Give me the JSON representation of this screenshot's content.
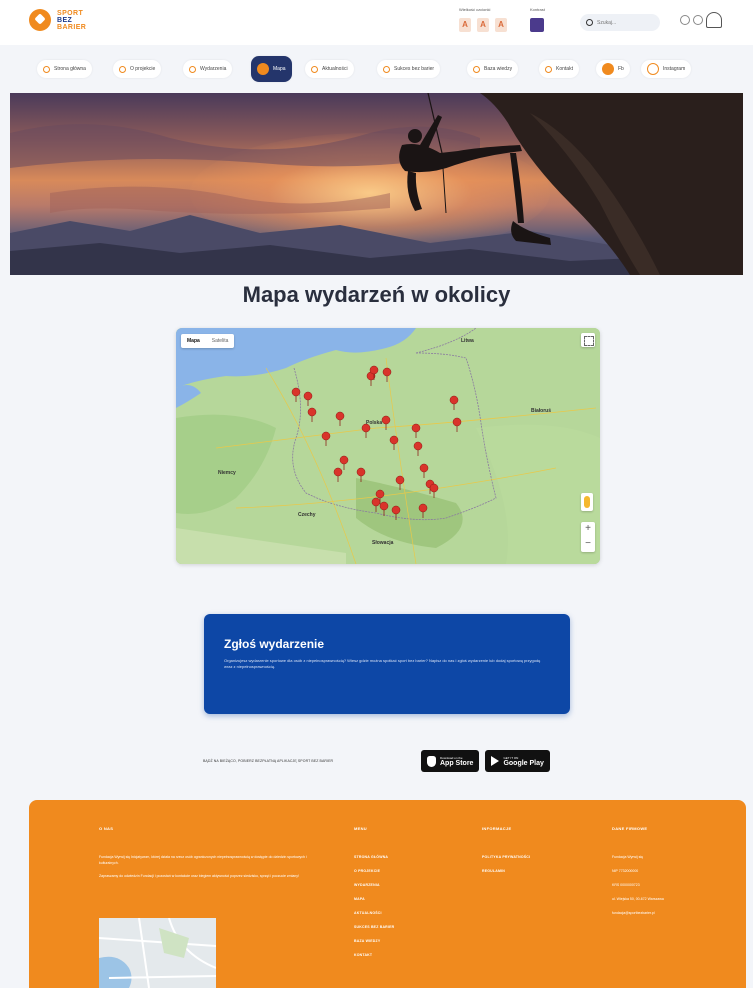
{
  "brand": {
    "logo_lines": [
      "SPORT",
      "BEZ",
      "BARIER"
    ]
  },
  "header": {
    "font_size_label": "Wielkość czcionki",
    "font_size_buttons": [
      "A",
      "A",
      "A"
    ],
    "contrast_label": "Kontrast",
    "search_placeholder": "Szukaj..."
  },
  "nav": {
    "items": [
      {
        "label": "Strona główna"
      },
      {
        "label": "O projekcie"
      },
      {
        "label": "Wydarzenia"
      },
      {
        "label": "Mapa",
        "active": true
      },
      {
        "label": "Aktualności"
      },
      {
        "label": "Sukces bez barier"
      },
      {
        "label": "Baza wiedzy"
      },
      {
        "label": "Kontakt"
      },
      {
        "label": "Fb"
      },
      {
        "label": "Instagram"
      }
    ]
  },
  "page": {
    "title": "Mapa wydarzeń w okolicy"
  },
  "map": {
    "toggle": [
      "Mapa",
      "Satelita"
    ],
    "labels": [
      "Litwa",
      "Polska",
      "Białoruś",
      "Niemcy",
      "Czechy",
      "Słowacja"
    ],
    "zoom_in": "+",
    "zoom_out": "−"
  },
  "report": {
    "title": "Zgłoś wydarzenie",
    "text": "Organizujesz wydarzenie sportowe dla osób z niepełnosprawnością? Wiesz gdzie można spotkać sport bez barier? Napisz do nas i zgłoś wydarzenie lub dodaj sportową przygodę wraz z niepełnosprawnością."
  },
  "app": {
    "text": "BĄDŹ NA BIEŻĄCO, POBIERZ BEZPŁATNĄ APLIKACJĘ SPORT BEZ BARIER",
    "appstore_small": "Download on the",
    "appstore_big": "App Store",
    "gplay_small": "GET IT ON",
    "gplay_big": "Google Play"
  },
  "footer": {
    "about_heading": "O NAS",
    "about_p1": "Fundacja Wyrwij się Inicjatywom, której działa na rzecz osób ograniczonych niepełnosprawnością w dostępie do dziedzin sportowych i kulturalnych.",
    "about_p2": "Zapraszamy do odwiedzin Fundacji i pozostań w kontakcie oraz biegiem aktywności poprzez siedzisko, sprzęt i poczucie zmiany!",
    "menu_heading": "MENU",
    "menu_links": [
      "STRONA GŁÓWNA",
      "O PROJEKCIE",
      "WYDARZENIA",
      "MAPA",
      "AKTUALNOŚCI",
      "SUKCES BEZ BARIER",
      "BAZA WIEDZY",
      "KONTAKT"
    ],
    "info_heading": "INFORMACJE",
    "info_links": [
      "POLITYKA PRYWATNOŚCI",
      "REGULAMIN"
    ],
    "contact_heading": "DANE FIRMOWE",
    "contact_lines": [
      "Fundacja Wyrwij się",
      "NIP 7732000000",
      "KRS 0000000723",
      "ul. Wiejska 50, 00-672 Warszawa",
      "fundacja@sportbezbarier.pl"
    ]
  },
  "colors": {
    "accent": "#f08a1e",
    "navy": "#24356b",
    "blue": "#0d47a6"
  }
}
